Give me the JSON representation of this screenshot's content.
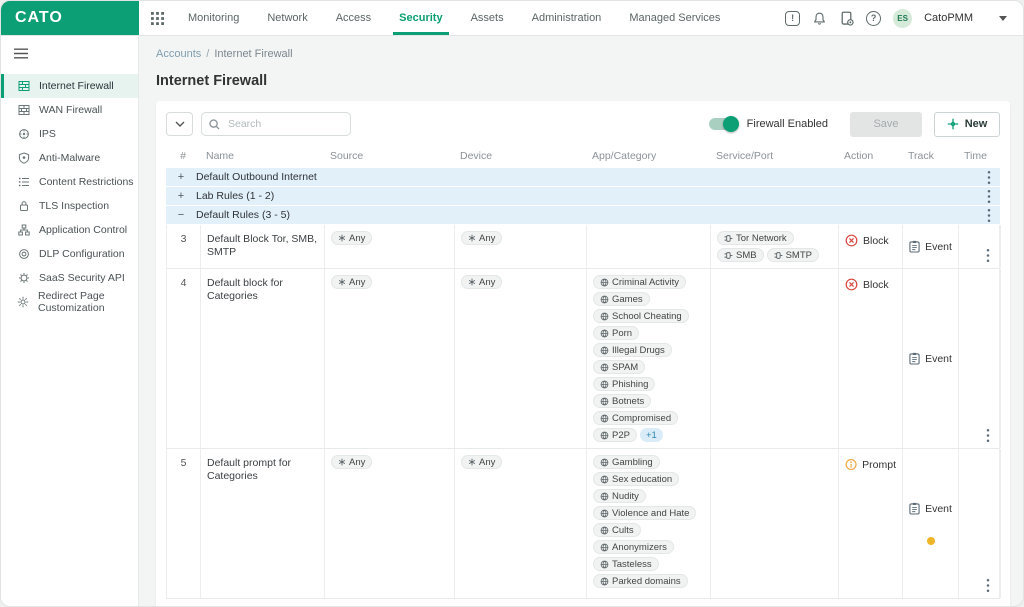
{
  "brand": {
    "logo": "CATO"
  },
  "topnav": {
    "items": [
      {
        "label": "Monitoring",
        "active": false
      },
      {
        "label": "Network",
        "active": false
      },
      {
        "label": "Access",
        "active": false
      },
      {
        "label": "Security",
        "active": true
      },
      {
        "label": "Assets",
        "active": false
      },
      {
        "label": "Administration",
        "active": false
      },
      {
        "label": "Managed Services",
        "active": false
      }
    ]
  },
  "header": {
    "account_name": "CatoPMM",
    "avatar_initials": "ES",
    "alert_badge": "!",
    "help_badge": "?"
  },
  "sidebar": {
    "items": [
      {
        "label": "Internet Firewall",
        "icon": "internet-firewall-icon",
        "active": true
      },
      {
        "label": "WAN Firewall",
        "icon": "wan-firewall-icon",
        "active": false
      },
      {
        "label": "IPS",
        "icon": "ips-icon",
        "active": false
      },
      {
        "label": "Anti-Malware",
        "icon": "anti-malware-icon",
        "active": false
      },
      {
        "label": "Content Restrictions",
        "icon": "content-restrictions-icon",
        "active": false
      },
      {
        "label": "TLS Inspection",
        "icon": "tls-inspection-icon",
        "active": false
      },
      {
        "label": "Application Control",
        "icon": "application-control-icon",
        "active": false
      },
      {
        "label": "DLP Configuration",
        "icon": "dlp-configuration-icon",
        "active": false
      },
      {
        "label": "SaaS Security API",
        "icon": "saas-security-api-icon",
        "active": false
      },
      {
        "label": "Redirect Page Customization",
        "icon": "redirect-page-icon",
        "active": false
      }
    ]
  },
  "breadcrumb": {
    "parent": "Accounts",
    "separator": "/",
    "current": "Internet Firewall"
  },
  "page": {
    "title": "Internet Firewall"
  },
  "toolbar": {
    "search_placeholder": "Search",
    "firewall_toggle_label": "Firewall Enabled",
    "firewall_enabled": true,
    "save_label": "Save",
    "new_label": "New"
  },
  "table": {
    "columns": [
      "#",
      "Name",
      "Source",
      "Device",
      "App/Category",
      "Service/Port",
      "Action",
      "Track",
      "Time"
    ],
    "rows": [
      {
        "type": "group",
        "label": "Default Outbound Internet",
        "state": "collapsed"
      },
      {
        "type": "group",
        "label": "Lab Rules (1 - 2)",
        "state": "collapsed"
      },
      {
        "type": "group",
        "label": "Default Rules (3 - 5)",
        "state": "expanded"
      },
      {
        "type": "rule",
        "num": "3",
        "name": "Default Block Tor, SMB, SMTP",
        "source": "Any",
        "device": "Any",
        "apps": [],
        "services": [
          "Tor Network",
          "SMB",
          "SMTP"
        ],
        "action": {
          "label": "Block",
          "kind": "block"
        },
        "track": {
          "label": "Event",
          "dot": false
        },
        "min_height": 42
      },
      {
        "type": "rule",
        "num": "4",
        "name": "Default block for Categories",
        "source": "Any",
        "device": "Any",
        "apps": [
          "Criminal Activity",
          "Games",
          "School Cheating",
          "Porn",
          "Illegal Drugs",
          "SPAM",
          "Phishing",
          "Botnets",
          "Compromised",
          "P2P"
        ],
        "apps_overflow": "+1",
        "services": [],
        "action": {
          "label": "Block",
          "kind": "block"
        },
        "track": {
          "label": "Event",
          "dot": false
        },
        "min_height": 160
      },
      {
        "type": "rule",
        "num": "5",
        "name": "Default prompt for Categories",
        "source": "Any",
        "device": "Any",
        "apps": [
          "Gambling",
          "Sex education",
          "Nudity",
          "Violence and Hate",
          "Cults",
          "Anonymizers",
          "Tasteless",
          "Parked domains"
        ],
        "services": [],
        "action": {
          "label": "Prompt",
          "kind": "prompt"
        },
        "track": {
          "label": "Event",
          "dot": true
        },
        "min_height": 150
      }
    ]
  },
  "icons": {
    "any_chip": "asterisk-icon",
    "service_chip": "plug-icon",
    "category_chip": "category-icon",
    "action_block": "block-icon",
    "action_prompt": "prompt-icon",
    "track_event": "event-icon",
    "row_menu": "kebab-icon"
  },
  "colors": {
    "brand_green": "#0c9e74",
    "group_row_bg": "#e2f0fa",
    "block_red": "#d9463e",
    "prompt_orange": "#f0a43c",
    "track_dot_orange": "#f0b429",
    "breadcrumb_link": "#7f9dae",
    "avatar_bg": "#d5ead9"
  }
}
